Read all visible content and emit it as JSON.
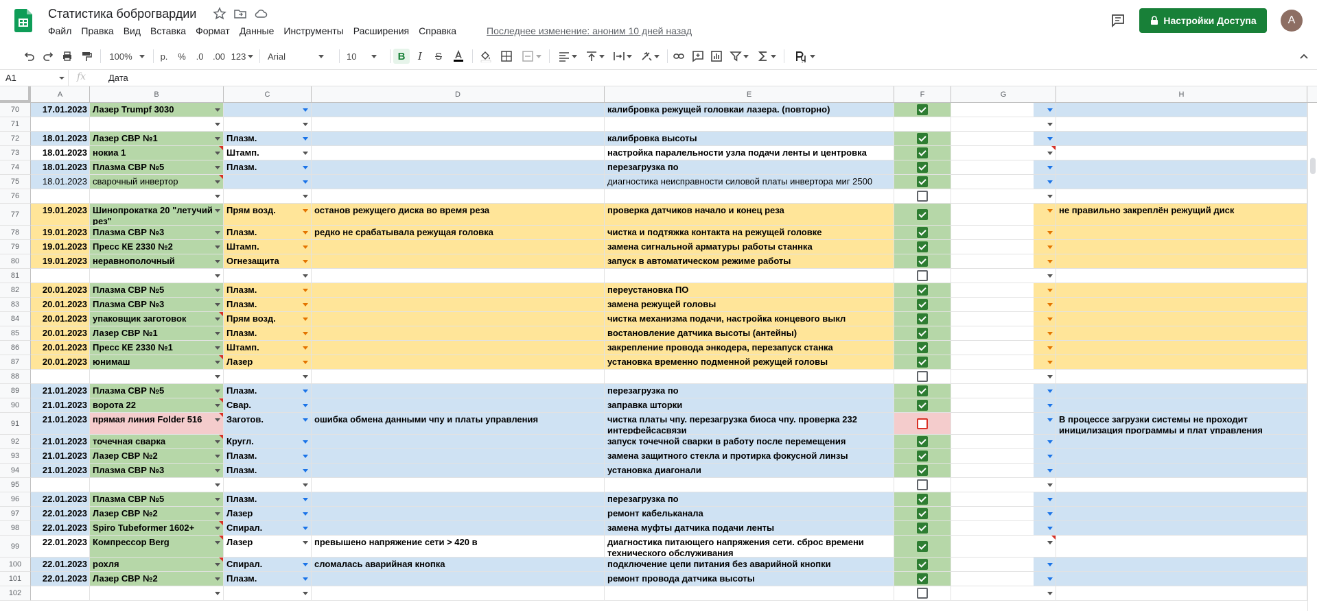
{
  "title": "Статистика боброгвардии",
  "menu": [
    "Файл",
    "Правка",
    "Вид",
    "Вставка",
    "Формат",
    "Данные",
    "Инструменты",
    "Расширения",
    "Справка"
  ],
  "last_edit": "Последнее изменение: аноним 10 дней назад",
  "share_label": "Настройки Доступа",
  "avatar_letter": "A",
  "toolbar": {
    "zoom": "100%",
    "currency": "р.",
    "percent": "%",
    "dec_dec": ".0",
    "dec_inc": ".00",
    "format": "123",
    "font": "Arial",
    "font_size": "10"
  },
  "namebox": "A1",
  "fx": "fx",
  "formula": "Дата",
  "columns": [
    "A",
    "B",
    "C",
    "D",
    "E",
    "F",
    "G",
    "H"
  ],
  "rows": [
    {
      "n": "70",
      "date": "17.01.2023",
      "b": "Лазер Trumpf 3030",
      "c": "",
      "d": "",
      "e": "калибровка режущей головкаи лазера. (повторно)",
      "f": "on",
      "h": "",
      "bg": "blue",
      "rc_b": false,
      "rc_g": false
    },
    {
      "n": "71",
      "date": "",
      "b": "",
      "c": "",
      "d": "",
      "e": "",
      "f": "none",
      "h": "",
      "bg": "white"
    },
    {
      "n": "72",
      "date": "18.01.2023",
      "b": "Лазер СВР №1",
      "c": "Плазм.",
      "d": "",
      "e": "калибровка высоты",
      "f": "on",
      "h": "",
      "bg": "blue"
    },
    {
      "n": "73",
      "date": "18.01.2023",
      "b": "нокиа 1",
      "c": "Штамп.",
      "d": "",
      "e": "настройка паралельности узла подачи ленты и центровка",
      "f": "on",
      "h": "",
      "bg": "white",
      "rc_b": true,
      "rc_g": true
    },
    {
      "n": "74",
      "date": "18.01.2023",
      "b": "Плазма СВР №5",
      "c": "Плазм.",
      "d": "",
      "e": "перезагрузка по",
      "f": "on",
      "h": "",
      "bg": "blue"
    },
    {
      "n": "75",
      "date": "18.01.2023",
      "b": "сварочный инвертор",
      "c": "",
      "d": "",
      "e": "диагностика неисправности  силовой платы инвертора  миг 2500",
      "f": "on",
      "h": "",
      "bg": "blue",
      "normal": true,
      "rc_b": true
    },
    {
      "n": "76",
      "date": "",
      "b": "",
      "c": "",
      "d": "",
      "e": "",
      "f": "off",
      "h": "",
      "bg": "white"
    },
    {
      "n": "77",
      "date": "19.01.2023",
      "b": "Шинопрокатка 20 \"летучий рез\"",
      "c": "Прям возд.",
      "d": "останов режущего диска во время реза",
      "e": "проверка датчиков начало и конец реза",
      "f": "on",
      "h": "не правильно закреплён режущий диск",
      "bg": "orange",
      "tall": true
    },
    {
      "n": "78",
      "date": "19.01.2023",
      "b": "Плазма СВР №3",
      "c": "Плазм.",
      "d": "редко не срабатывала режущая головка",
      "e": "чистка и подтяжка контакта на режущей головке",
      "f": "on",
      "h": "",
      "bg": "orange"
    },
    {
      "n": "79",
      "date": "19.01.2023",
      "b": "Пресс КЕ 2330 №2",
      "c": "Штамп.",
      "d": "",
      "e": "замена сигнальной арматуры работы станнка",
      "f": "on",
      "h": "",
      "bg": "orange"
    },
    {
      "n": "80",
      "date": "19.01.2023",
      "b": "неравнополочный",
      "c": "Огнезащита",
      "d": "",
      "e": "запуск в автоматическом режиме работы",
      "f": "on",
      "h": "",
      "bg": "orange"
    },
    {
      "n": "81",
      "date": "",
      "b": "",
      "c": "",
      "d": "",
      "e": "",
      "f": "off",
      "h": "",
      "bg": "white"
    },
    {
      "n": "82",
      "date": "20.01.2023",
      "b": "Плазма СВР №5",
      "c": "Плазм.",
      "d": "",
      "e": "переустановка ПО",
      "f": "on",
      "h": "",
      "bg": "orange"
    },
    {
      "n": "83",
      "date": "20.01.2023",
      "b": "Плазма СВР №3",
      "c": "Плазм.",
      "d": "",
      "e": "замена режущей головы",
      "f": "on",
      "h": "",
      "bg": "orange"
    },
    {
      "n": "84",
      "date": "20.01.2023",
      "b": "упаковщик заготовок",
      "c": "Прям возд.",
      "d": "",
      "e": "чистка механизма подачи, настройка концевого выкл",
      "f": "on",
      "h": "",
      "bg": "orange",
      "rc_b": true
    },
    {
      "n": "85",
      "date": "20.01.2023",
      "b": "Лазер СВР №1",
      "c": "Плазм.",
      "d": "",
      "e": "востановление датчика высоты (антейны)",
      "f": "on",
      "h": "",
      "bg": "orange"
    },
    {
      "n": "86",
      "date": "20.01.2023",
      "b": "Пресс КЕ 2330 №1",
      "c": "Штамп.",
      "d": "",
      "e": "закрепление провода энкодера, перезапуск станка",
      "f": "on",
      "h": "",
      "bg": "orange"
    },
    {
      "n": "87",
      "date": "20.01.2023",
      "b": "юнимаш",
      "c": "Лазер",
      "d": "",
      "e": "установка временно подменной режущей головы",
      "f": "on",
      "h": "",
      "bg": "orange",
      "rc_b": true
    },
    {
      "n": "88",
      "date": "",
      "b": "",
      "c": "",
      "d": "",
      "e": "",
      "f": "off",
      "h": "",
      "bg": "white"
    },
    {
      "n": "89",
      "date": "21.01.2023",
      "b": "Плазма СВР №5",
      "c": "Плазм.",
      "d": "",
      "e": "перезагрузка по",
      "f": "on",
      "h": "",
      "bg": "blue"
    },
    {
      "n": "90",
      "date": "21.01.2023",
      "b": "ворота 22",
      "c": "Свар.",
      "d": "",
      "e": "заправка шторки",
      "f": "on",
      "h": "",
      "bg": "blue",
      "rc_b": true
    },
    {
      "n": "91",
      "date": "21.01.2023",
      "b": "прямая линия Folder 516",
      "c": "Заготов.",
      "d": "ошибка обмена данными чпу и платы управления",
      "e": "чистка платы чпу. перезагрузка биоса чпу. проверка 232 интерфейсасвязи",
      "f": "red",
      "h": "В процессе загрузки системы не проходит иницилизация программы и плат управления",
      "bg": "blue",
      "bbg": "red",
      "tall": true,
      "rc_b": true
    },
    {
      "n": "92",
      "date": "21.01.2023",
      "b": "точечная сварка",
      "c": "Кругл.",
      "d": "",
      "e": "запуск точечной сварки в работу после перемещения",
      "f": "on",
      "h": "",
      "bg": "blue",
      "rc_b": true
    },
    {
      "n": "93",
      "date": "21.01.2023",
      "b": "Лазер СВР №2",
      "c": "Плазм.",
      "d": "",
      "e": "замена защитного стекла и протирка фокусной линзы",
      "f": "on",
      "h": "",
      "bg": "blue"
    },
    {
      "n": "94",
      "date": "21.01.2023",
      "b": "Плазма СВР №3",
      "c": "Плазм.",
      "d": "",
      "e": "установка диагонали",
      "f": "on",
      "h": "",
      "bg": "blue"
    },
    {
      "n": "95",
      "date": "",
      "b": "",
      "c": "",
      "d": "",
      "e": "",
      "f": "off",
      "h": "",
      "bg": "white"
    },
    {
      "n": "96",
      "date": "22.01.2023",
      "b": "Плазма СВР №5",
      "c": "Плазм.",
      "d": "",
      "e": "перезагрузка по",
      "f": "on",
      "h": "",
      "bg": "blue"
    },
    {
      "n": "97",
      "date": "22.01.2023",
      "b": "Лазер СВР №2",
      "c": "Лазер",
      "d": "",
      "e": "ремонт кабельканала",
      "f": "on",
      "h": "",
      "bg": "blue"
    },
    {
      "n": "98",
      "date": "22.01.2023",
      "b": "Spiro Tubeformer 1602+",
      "c": "Спирал.",
      "d": "",
      "e": "замена муфты датчика подачи ленты",
      "f": "on",
      "h": "",
      "bg": "blue",
      "rc_b": true
    },
    {
      "n": "99",
      "date": "22.01.2023",
      "b": "Компрессор Berg",
      "c": "Лазер",
      "d": "превышено напряжение сети > 420 в",
      "e": "диагностика питающего напряжения сети. сброс времени технического обслуживания",
      "f": "on",
      "h": "",
      "bg": "white",
      "tall": true,
      "rc_b": true,
      "rc_g": true
    },
    {
      "n": "100",
      "date": "22.01.2023",
      "b": "рохля",
      "c": "Спирал.",
      "d": "сломалась аварийная кнопка",
      "e": "подключение цепи питания без аварийной кнопки",
      "f": "on",
      "h": "",
      "bg": "blue",
      "rc_b": true
    },
    {
      "n": "101",
      "date": "22.01.2023",
      "b": "Лазер СВР №2",
      "c": "Плазм.",
      "d": "",
      "e": "ремонт провода датчика высоты",
      "f": "on",
      "h": "",
      "bg": "blue"
    },
    {
      "n": "102",
      "date": "",
      "b": "",
      "c": "",
      "d": "",
      "e": "",
      "f": "off",
      "h": "",
      "bg": "white"
    }
  ]
}
